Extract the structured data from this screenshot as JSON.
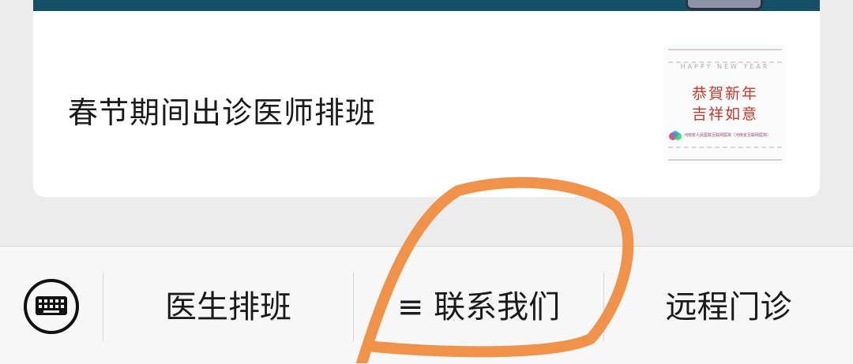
{
  "article": {
    "title": "春节期间出诊医师排班",
    "thumbnail": {
      "caption": "HAPPY NEW YEAR",
      "greeting_line1": "恭賀新年",
      "greeting_line2": "吉祥如意",
      "organization": "河南省人民医院互联网医院（河南省互联网医院）"
    }
  },
  "menu": {
    "keyboard_icon": "keyboard-icon",
    "items": [
      {
        "label": "医生排班"
      },
      {
        "label": "≡ 联系我们"
      },
      {
        "label": "远程门诊"
      }
    ]
  },
  "colors": {
    "banner": "#145166",
    "greeting_red": "#c0392b",
    "annotation_orange": "#f0924a"
  }
}
